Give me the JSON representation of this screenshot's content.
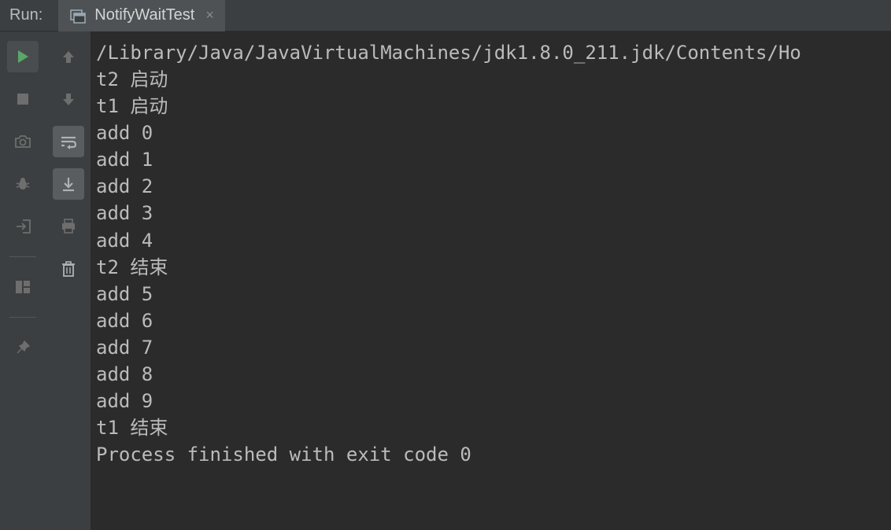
{
  "header": {
    "run_label": "Run:",
    "tab_label": "NotifyWaitTest",
    "tab_close": "×"
  },
  "console": {
    "lines": [
      "/Library/Java/JavaVirtualMachines/jdk1.8.0_211.jdk/Contents/Ho",
      "t2 启动",
      "t1 启动",
      "add 0",
      "add 1",
      "add 2",
      "add 3",
      "add 4",
      "t2 结束",
      "add 5",
      "add 6",
      "add 7",
      "add 8",
      "add 9",
      "t1 结束",
      "",
      "Process finished with exit code 0"
    ]
  },
  "icons": {
    "run": "run-icon",
    "stop": "stop-icon",
    "camera": "camera-icon",
    "bug": "bug-icon",
    "exit": "exit-icon",
    "layout": "layout-icon",
    "pin": "pin-icon",
    "up": "up-arrow-icon",
    "down": "down-arrow-icon",
    "wrap": "soft-wrap-icon",
    "scroll": "scroll-to-end-icon",
    "print": "print-icon",
    "trash": "trash-icon",
    "application": "application-icon"
  }
}
